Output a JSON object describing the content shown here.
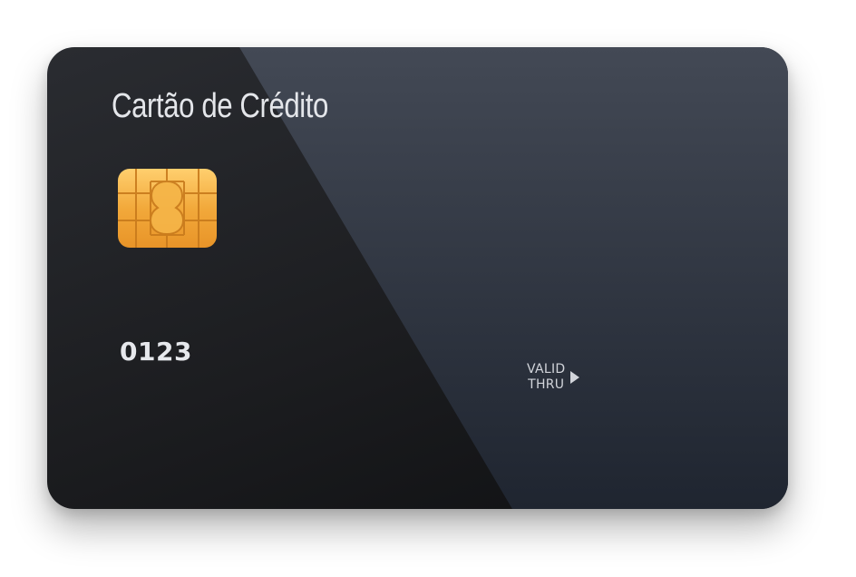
{
  "card": {
    "title": "Cartão de Crédito",
    "number": "0123",
    "valid_thru": {
      "line1": "VALID",
      "line2": "THRU"
    }
  },
  "icons": {
    "chip": "emv-chip-icon",
    "arrow": "triangle-right-icon"
  },
  "colors": {
    "card_dark": "#1c1d20",
    "card_light_panel": "#3b414c",
    "chip_gold": "#f0a838",
    "text": "#e4e6ea"
  }
}
